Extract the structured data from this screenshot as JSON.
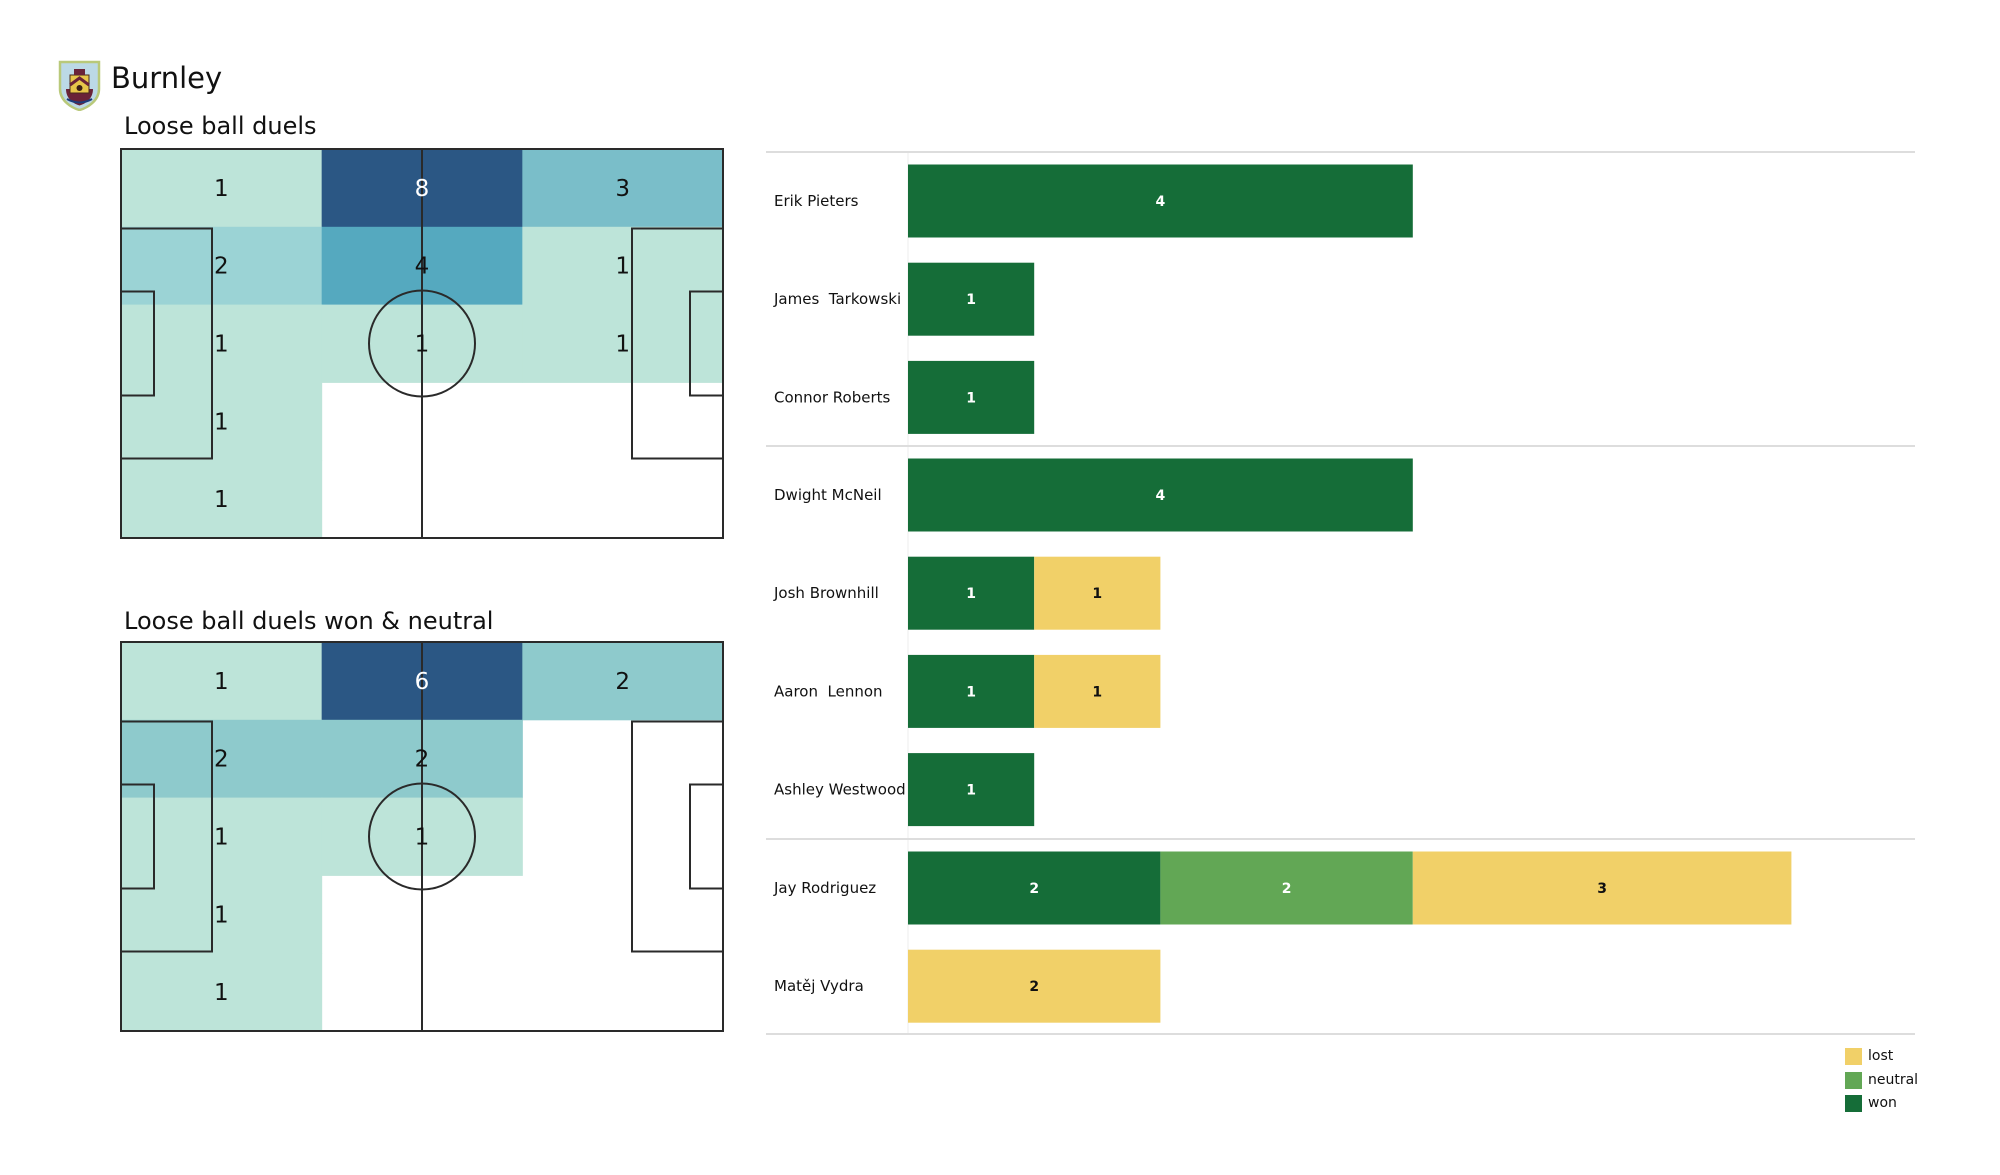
{
  "header": {
    "team_name": "Burnley",
    "crest_icon": "burnley-crest-icon"
  },
  "colors": {
    "won": "#156d38",
    "neutral": "#62a755",
    "lost": "#f1d068",
    "heat_scale": [
      "#bde4d9",
      "#9bd3d5",
      "#7abec9",
      "#55a9bf",
      "#2b5784"
    ],
    "pitch_line": "#2a2a2a",
    "separator": "#dddddd"
  },
  "chart_data": [
    {
      "type": "heatmap",
      "title": "Loose ball duels",
      "grid": {
        "columns": 3,
        "rows": 5
      },
      "cells": [
        [
          1,
          8,
          3
        ],
        [
          2,
          4,
          1
        ],
        [
          1,
          1,
          1
        ],
        [
          1,
          0,
          0
        ],
        [
          1,
          0,
          0
        ]
      ],
      "vmax": 8
    },
    {
      "type": "heatmap",
      "title": "Loose ball duels won & neutral",
      "grid": {
        "columns": 3,
        "rows": 5
      },
      "cells": [
        [
          1,
          6,
          2
        ],
        [
          2,
          2,
          0
        ],
        [
          1,
          1,
          0
        ],
        [
          1,
          0,
          0
        ],
        [
          1,
          0,
          0
        ]
      ],
      "vmax": 6
    },
    {
      "type": "bar",
      "orientation": "horizontal",
      "stacked": true,
      "title": "",
      "xlabel": "",
      "ylabel": "",
      "xlim": [
        0,
        7
      ],
      "legend": {
        "position": "bottom-right",
        "entries": [
          "lost",
          "neutral",
          "won"
        ]
      },
      "series_order": [
        "won",
        "neutral",
        "lost"
      ],
      "groups": [
        {
          "players": [
            {
              "name": "Erik Pieters",
              "won": 4,
              "neutral": 0,
              "lost": 0
            },
            {
              "name": "James  Tarkowski",
              "won": 1,
              "neutral": 0,
              "lost": 0
            },
            {
              "name": "Connor Roberts",
              "won": 1,
              "neutral": 0,
              "lost": 0
            }
          ]
        },
        {
          "players": [
            {
              "name": "Dwight McNeil",
              "won": 4,
              "neutral": 0,
              "lost": 0
            },
            {
              "name": "Josh Brownhill",
              "won": 1,
              "neutral": 0,
              "lost": 1
            },
            {
              "name": "Aaron  Lennon",
              "won": 1,
              "neutral": 0,
              "lost": 1
            },
            {
              "name": "Ashley Westwood",
              "won": 1,
              "neutral": 0,
              "lost": 0
            }
          ]
        },
        {
          "players": [
            {
              "name": "Jay Rodriguez",
              "won": 2,
              "neutral": 2,
              "lost": 3
            },
            {
              "name": "Matěj Vydra",
              "won": 0,
              "neutral": 0,
              "lost": 2
            }
          ]
        }
      ]
    }
  ],
  "legend": {
    "items": [
      {
        "key": "lost",
        "label": "lost"
      },
      {
        "key": "neutral",
        "label": "neutral"
      },
      {
        "key": "won",
        "label": "won"
      }
    ]
  }
}
